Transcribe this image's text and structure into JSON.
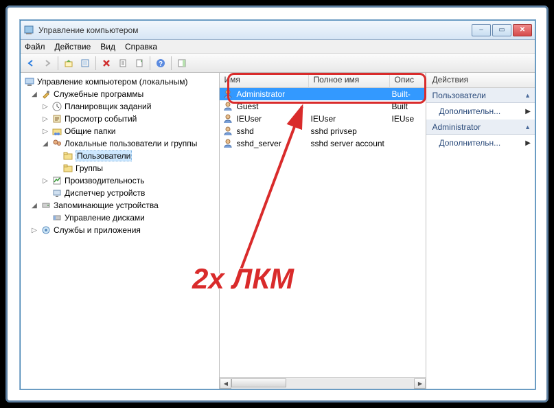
{
  "window": {
    "title": "Управление компьютером"
  },
  "menu": {
    "file": "Файл",
    "action": "Действие",
    "view": "Вид",
    "help": "Справка"
  },
  "tree": {
    "root": "Управление компьютером (локальным)",
    "services_programs": "Служебные программы",
    "task_scheduler": "Планировщик заданий",
    "event_viewer": "Просмотр событий",
    "shared_folders": "Общие папки",
    "local_users_groups": "Локальные пользователи и группы",
    "users": "Пользователи",
    "groups": "Группы",
    "performance": "Производительность",
    "device_manager": "Диспетчер устройств",
    "storage": "Запоминающие устройства",
    "disk_management": "Управление дисками",
    "services_apps": "Службы и приложения"
  },
  "list": {
    "columns": {
      "name": "Имя",
      "fullname": "Полное имя",
      "desc": "Опис"
    },
    "rows": [
      {
        "name": "Administrator",
        "fullname": "",
        "desc": "Built-",
        "selected": true
      },
      {
        "name": "Guest",
        "fullname": "",
        "desc": "Built"
      },
      {
        "name": "IEUser",
        "fullname": "IEUser",
        "desc": "IEUse"
      },
      {
        "name": "sshd",
        "fullname": "sshd privsep",
        "desc": ""
      },
      {
        "name": "sshd_server",
        "fullname": "sshd server account",
        "desc": ""
      }
    ]
  },
  "actions": {
    "header": "Действия",
    "group1": "Пользователи",
    "item1": "Дополнительн...",
    "group2": "Administrator",
    "item2": "Дополнительн..."
  },
  "annotation": {
    "text": "2х ЛКМ"
  }
}
